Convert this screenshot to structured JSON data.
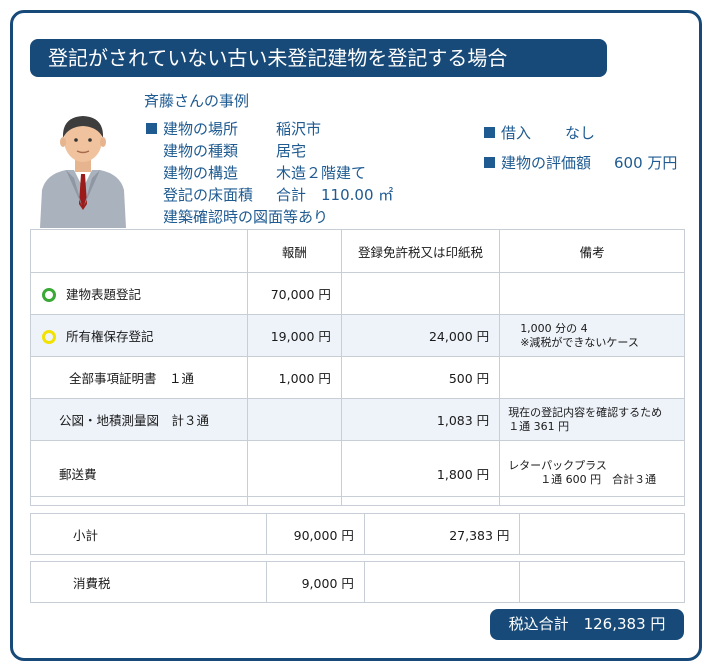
{
  "title": "登記がされていない古い未登記建物を登記する場合",
  "case_title": "斉藤さんの事例",
  "building_info": [
    {
      "label": "建物の場所",
      "value": "稲沢市"
    },
    {
      "label": "建物の種類",
      "value": "居宅"
    },
    {
      "label": "建物の構造",
      "value": "木造２階建て"
    },
    {
      "label": "登記の床面積",
      "value": "合計　110.00 ㎡"
    },
    {
      "label": "建築確認時の図面等あり",
      "value": ""
    }
  ],
  "side_info": [
    {
      "label": "借入",
      "value": "なし"
    },
    {
      "label": "建物の評価額",
      "value": "600 万円"
    }
  ],
  "table": {
    "headers": [
      "",
      "報酬",
      "登録免許税又は印紙税",
      "備考"
    ],
    "rows": [
      {
        "label": "建物表題登記",
        "fee": "70,000 円",
        "tax": "",
        "note1": "",
        "note2": ""
      },
      {
        "label": "所有権保存登記",
        "fee": "19,000 円",
        "tax": "24,000 円",
        "note1": "1,000 分の 4",
        "note2": "※減税ができないケース"
      },
      {
        "label": "全部事項証明書　１通",
        "fee": "1,000 円",
        "tax": "500 円",
        "note1": "",
        "note2": ""
      },
      {
        "label": "公図・地積測量図　計３通",
        "fee": "",
        "tax": "1,083 円",
        "note1": "現在の登記内容を確認するため",
        "note2": "１通 361 円"
      },
      {
        "label": "郵送費",
        "fee": "",
        "tax": "1,800 円",
        "note1": "レターパックプラス",
        "note2": "１通 600 円　合計３通"
      }
    ]
  },
  "summary": [
    {
      "label": "小計",
      "fee": "90,000 円",
      "tax": "27,383 円"
    },
    {
      "label": "消費税",
      "fee": "9,000 円",
      "tax": ""
    }
  ],
  "total": "税込合計　126,383 円",
  "colors": {
    "navy": "#174a78",
    "text_blue": "#1f5b91",
    "green_marker": "#3aa935",
    "yellow_marker": "#f2e200"
  }
}
